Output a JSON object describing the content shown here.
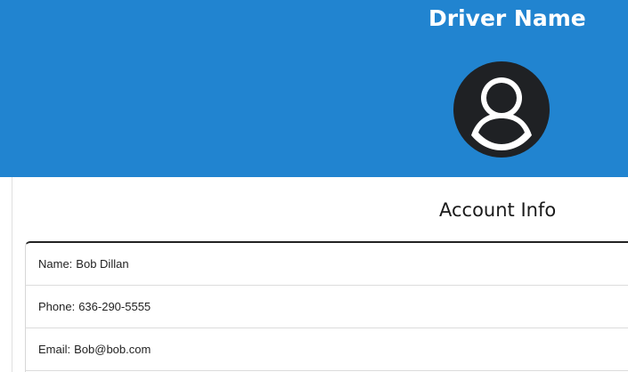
{
  "header": {
    "title": "Driver Name",
    "avatar_icon": "user-circle-icon",
    "background_color": "#2184d0"
  },
  "account": {
    "title": "Account Info",
    "rows": [
      {
        "label": "Name:",
        "value": "Bob Dillan"
      },
      {
        "label": "Phone:",
        "value": "636-290-5555"
      },
      {
        "label": "Email:",
        "value": "Bob@bob.com"
      }
    ]
  }
}
